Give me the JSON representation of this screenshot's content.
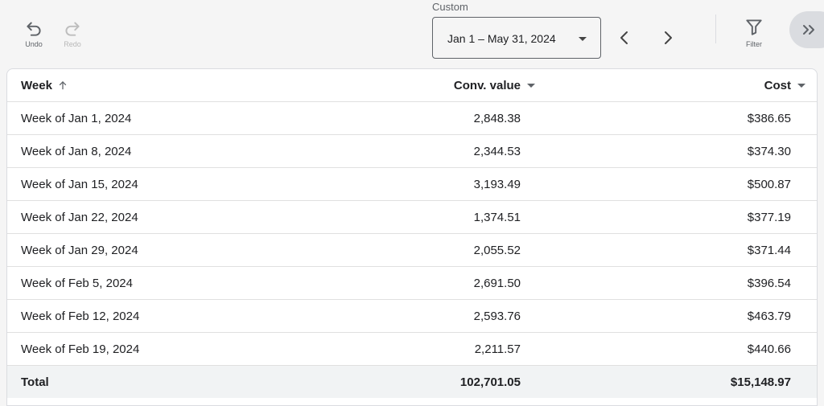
{
  "toolbar": {
    "undo_label": "Undo",
    "redo_label": "Redo",
    "date_range": {
      "label": "Custom",
      "value": "Jan 1 – May 31, 2024"
    },
    "filter_label": "Filter"
  },
  "table": {
    "columns": [
      "Week",
      "Conv. value",
      "Cost"
    ],
    "rows": [
      {
        "week": "Week of Jan 1, 2024",
        "conv_value": "2,848.38",
        "cost": "$386.65"
      },
      {
        "week": "Week of Jan 8, 2024",
        "conv_value": "2,344.53",
        "cost": "$374.30"
      },
      {
        "week": "Week of Jan 15, 2024",
        "conv_value": "3,193.49",
        "cost": "$500.87"
      },
      {
        "week": "Week of Jan 22, 2024",
        "conv_value": "1,374.51",
        "cost": "$377.19"
      },
      {
        "week": "Week of Jan 29, 2024",
        "conv_value": "2,055.52",
        "cost": "$371.44"
      },
      {
        "week": "Week of Feb 5, 2024",
        "conv_value": "2,691.50",
        "cost": "$396.54"
      },
      {
        "week": "Week of Feb 12, 2024",
        "conv_value": "2,593.76",
        "cost": "$463.79"
      },
      {
        "week": "Week of Feb 19, 2024",
        "conv_value": "2,211.57",
        "cost": "$440.66"
      }
    ],
    "total": {
      "label": "Total",
      "conv_value": "102,701.05",
      "cost": "$15,148.97"
    }
  },
  "icons": {
    "undo": "undo-icon",
    "redo": "redo-icon",
    "prev": "chevron-left-icon",
    "next": "chevron-right-icon",
    "filter": "filter-icon",
    "expand": "double-chevron-right-icon",
    "sort_asc": "arrow-up-icon",
    "sort_menu": "caret-down-icon"
  }
}
